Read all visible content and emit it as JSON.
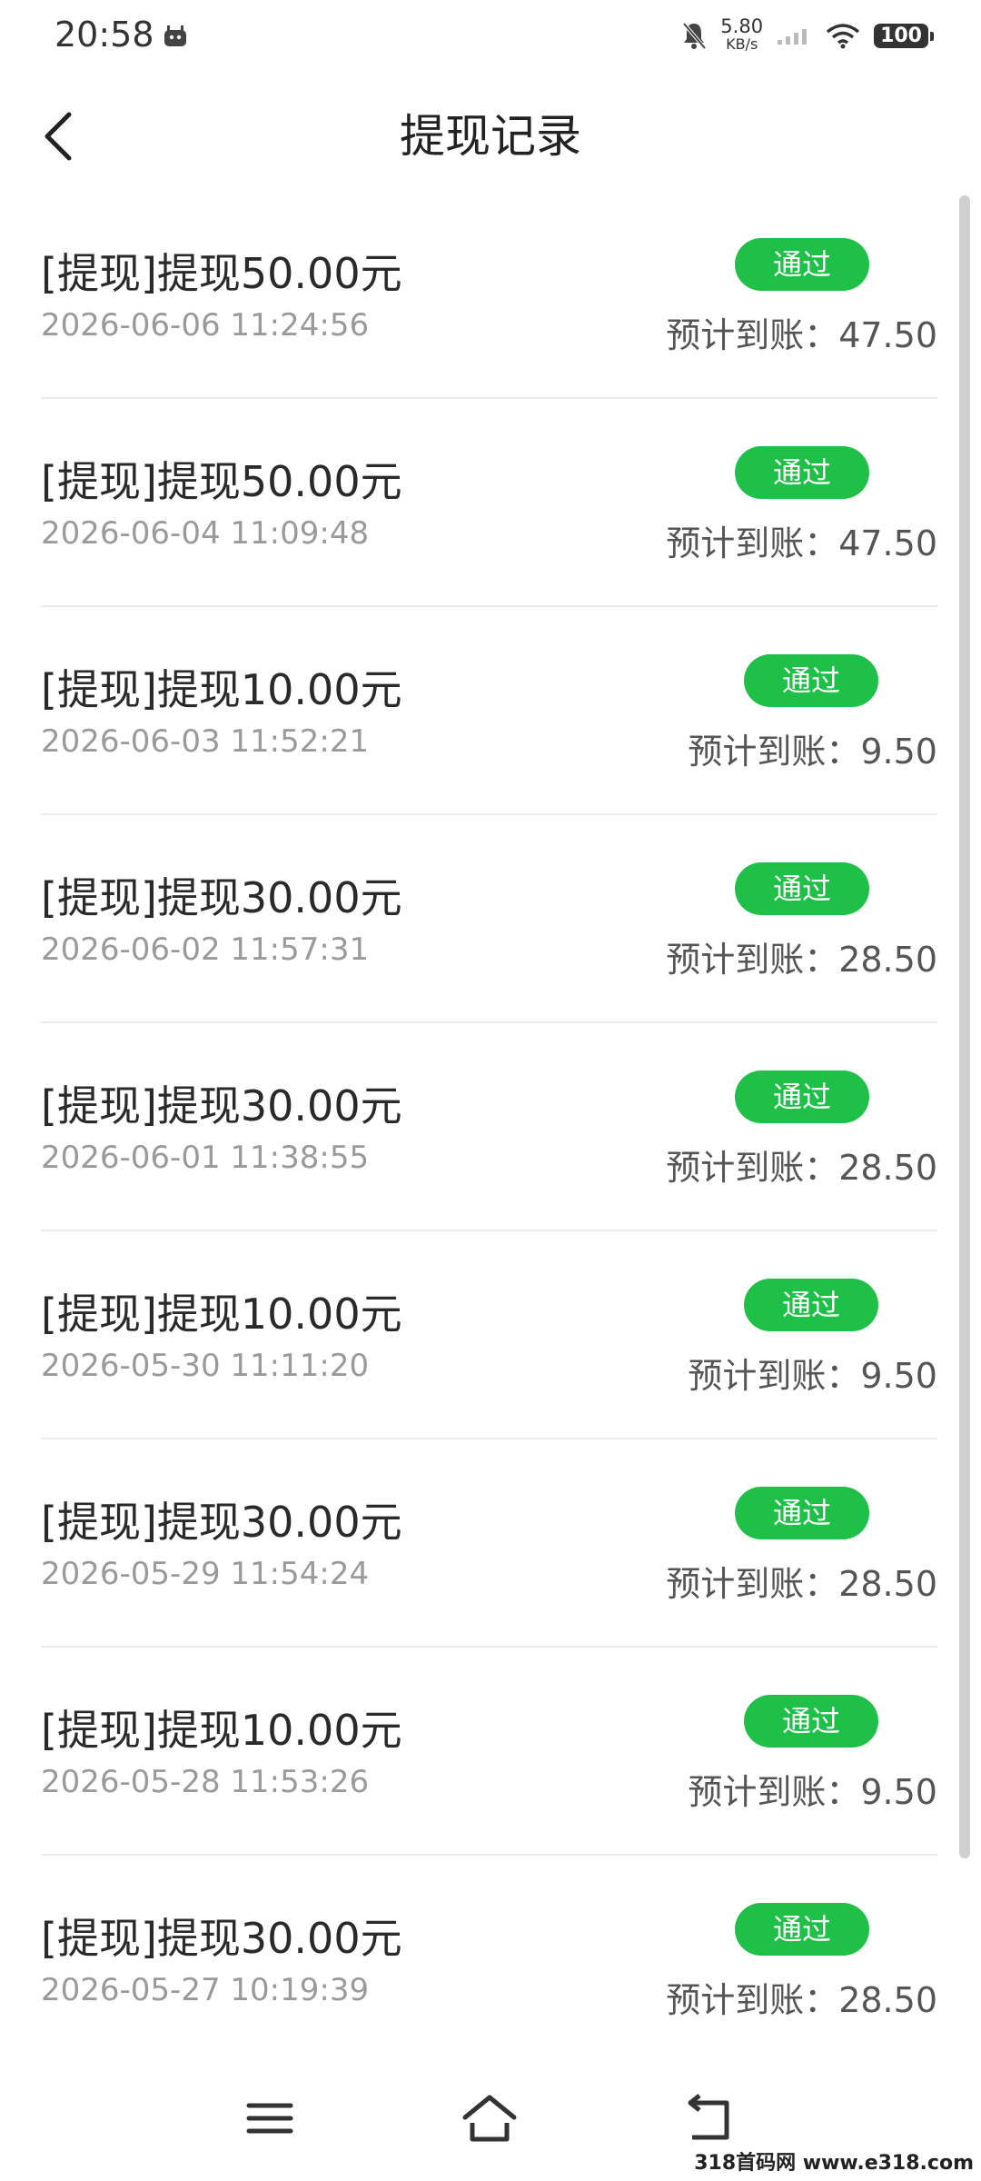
{
  "status_bar": {
    "time": "20:58",
    "net_speed_value": "5.80",
    "net_speed_unit": "KB/s",
    "battery": "100",
    "icons": [
      "android-robot-icon",
      "mute-bell-icon",
      "signal-icon",
      "wifi-icon",
      "battery-icon"
    ]
  },
  "header": {
    "back_icon": "chevron-left-icon",
    "title": "提现记录"
  },
  "records": [
    {
      "title": "[提现]提现50.00元",
      "time": "2026-06-06 11:24:56",
      "status": "通过",
      "expected": "预计到账：47.50"
    },
    {
      "title": "[提现]提现50.00元",
      "time": "2026-06-04 11:09:48",
      "status": "通过",
      "expected": "预计到账：47.50"
    },
    {
      "title": "[提现]提现10.00元",
      "time": "2026-06-03 11:52:21",
      "status": "通过",
      "expected": "预计到账：9.50"
    },
    {
      "title": "[提现]提现30.00元",
      "time": "2026-06-02 11:57:31",
      "status": "通过",
      "expected": "预计到账：28.50"
    },
    {
      "title": "[提现]提现30.00元",
      "time": "2026-06-01 11:38:55",
      "status": "通过",
      "expected": "预计到账：28.50"
    },
    {
      "title": "[提现]提现10.00元",
      "time": "2026-05-30 11:11:20",
      "status": "通过",
      "expected": "预计到账：9.50"
    },
    {
      "title": "[提现]提现30.00元",
      "time": "2026-05-29 11:54:24",
      "status": "通过",
      "expected": "预计到账：28.50"
    },
    {
      "title": "[提现]提现10.00元",
      "time": "2026-05-28 11:53:26",
      "status": "通过",
      "expected": "预计到账：9.50"
    },
    {
      "title": "[提现]提现30.00元",
      "time": "2026-05-27 10:19:39",
      "status": "通过",
      "expected": "预计到账：28.50"
    }
  ],
  "colors": {
    "badge": "#1ec048",
    "title_text": "#2a2a2a",
    "time_text": "#9a9a9a",
    "divider": "#ececec"
  },
  "nav_bar": {
    "icons": [
      "menu-icon",
      "home-icon",
      "back-icon"
    ]
  },
  "watermark": "318首码网 www.e318.com"
}
